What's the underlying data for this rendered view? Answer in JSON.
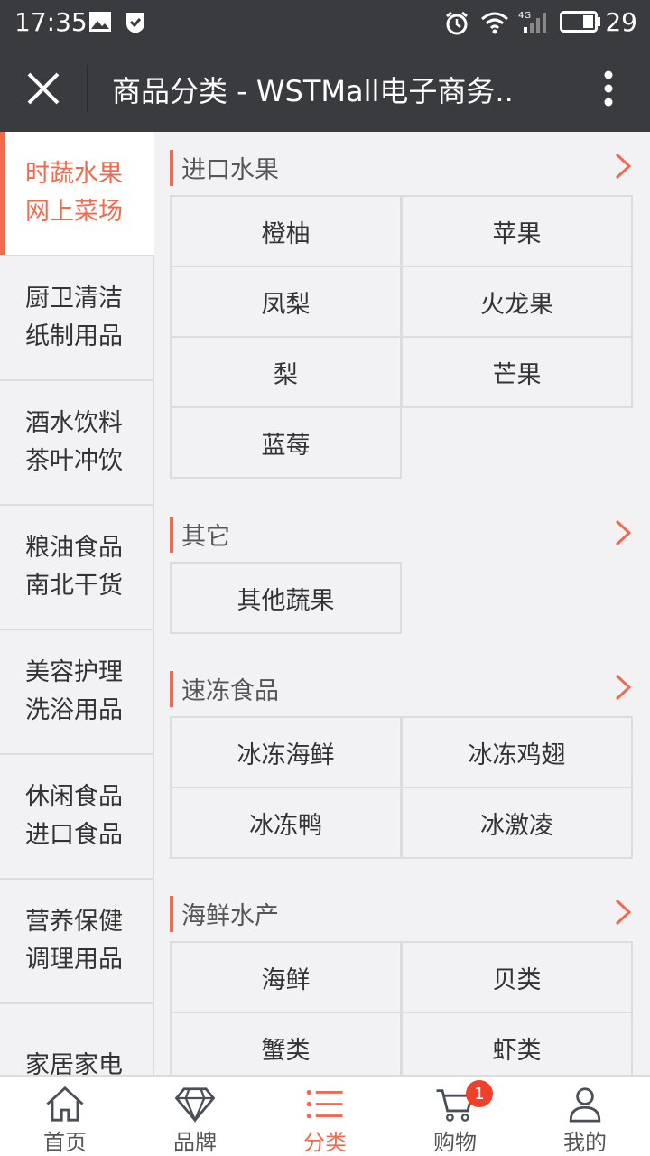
{
  "status": {
    "time": "17:35",
    "battery": "29",
    "network": "4G"
  },
  "appbar": {
    "title": "商品分类 - WSTMall电子商务.."
  },
  "sidebar": {
    "items": [
      {
        "line1": "时蔬水果",
        "line2": "网上菜场"
      },
      {
        "line1": "厨卫清洁",
        "line2": "纸制用品"
      },
      {
        "line1": "酒水饮料",
        "line2": "茶叶冲饮"
      },
      {
        "line1": "粮油食品",
        "line2": "南北干货"
      },
      {
        "line1": "美容护理",
        "line2": "洗浴用品"
      },
      {
        "line1": "休闲食品",
        "line2": "进口食品"
      },
      {
        "line1": "营养保健",
        "line2": "调理用品"
      },
      {
        "line1": "家居家电",
        "line2": ""
      }
    ]
  },
  "sections": [
    {
      "title": "进口水果",
      "items": [
        "橙柚",
        "苹果",
        "凤梨",
        "火龙果",
        "梨",
        "芒果",
        "蓝莓"
      ]
    },
    {
      "title": "其它",
      "items": [
        "其他蔬果"
      ]
    },
    {
      "title": "速冻食品",
      "items": [
        "冰冻海鲜",
        "冰冻鸡翅",
        "冰冻鸭",
        "冰激凌"
      ]
    },
    {
      "title": "海鲜水产",
      "items": [
        "海鲜",
        "贝类",
        "蟹类",
        "虾类"
      ]
    }
  ],
  "nav": {
    "items": [
      {
        "label": "首页",
        "icon": "home-icon"
      },
      {
        "label": "品牌",
        "icon": "diamond-icon"
      },
      {
        "label": "分类",
        "icon": "list-icon"
      },
      {
        "label": "购物",
        "icon": "cart-icon"
      },
      {
        "label": "我的",
        "icon": "user-icon"
      }
    ],
    "cart_badge": "1"
  },
  "colors": {
    "accent": "#f06a4d",
    "appbar": "#3a3b3f",
    "badge": "#f0402c"
  }
}
